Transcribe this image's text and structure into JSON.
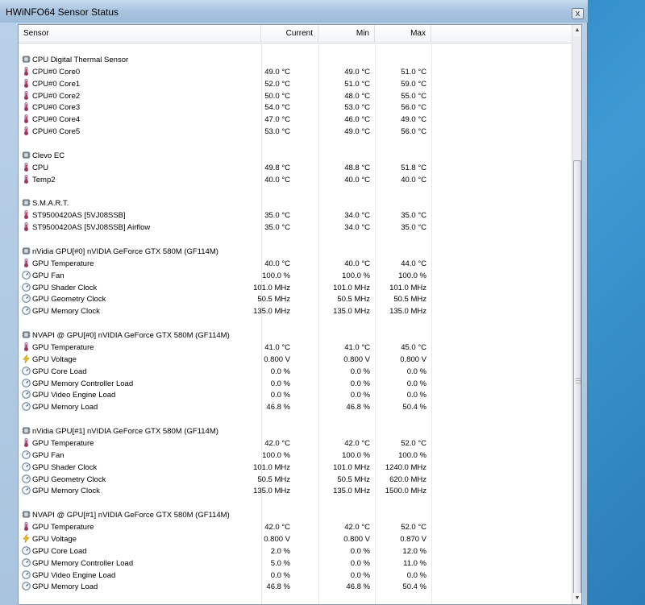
{
  "window": {
    "title": "HWiNFO64 Sensor Status",
    "close_label": "x"
  },
  "columns": {
    "sensor": "Sensor",
    "current": "Current",
    "min": "Min",
    "max": "Max"
  },
  "rows": [
    {
      "type": "blank"
    },
    {
      "type": "group",
      "name": "CPU Digital Thermal Sensor"
    },
    {
      "type": "sensor",
      "icon": "thermometer",
      "name": "CPU#0 Core0",
      "cur": "49.0 °C",
      "min": "49.0 °C",
      "max": "51.0 °C"
    },
    {
      "type": "sensor",
      "icon": "thermometer",
      "name": "CPU#0 Core1",
      "cur": "52.0 °C",
      "min": "51.0 °C",
      "max": "59.0 °C"
    },
    {
      "type": "sensor",
      "icon": "thermometer",
      "name": "CPU#0 Core2",
      "cur": "50.0 °C",
      "min": "48.0 °C",
      "max": "55.0 °C"
    },
    {
      "type": "sensor",
      "icon": "thermometer",
      "name": "CPU#0 Core3",
      "cur": "54.0 °C",
      "min": "53.0 °C",
      "max": "56.0 °C"
    },
    {
      "type": "sensor",
      "icon": "thermometer",
      "name": "CPU#0 Core4",
      "cur": "47.0 °C",
      "min": "46.0 °C",
      "max": "49.0 °C"
    },
    {
      "type": "sensor",
      "icon": "thermometer",
      "name": "CPU#0 Core5",
      "cur": "53.0 °C",
      "min": "49.0 °C",
      "max": "56.0 °C"
    },
    {
      "type": "blank"
    },
    {
      "type": "group",
      "name": "Clevo EC"
    },
    {
      "type": "sensor",
      "icon": "thermometer",
      "name": "CPU",
      "cur": "49.8 °C",
      "min": "48.8 °C",
      "max": "51.8 °C"
    },
    {
      "type": "sensor",
      "icon": "thermometer",
      "name": "Temp2",
      "cur": "40.0 °C",
      "min": "40.0 °C",
      "max": "40.0 °C"
    },
    {
      "type": "blank"
    },
    {
      "type": "group",
      "name": "S.M.A.R.T."
    },
    {
      "type": "sensor",
      "icon": "thermometer",
      "name": "ST9500420AS [5VJ08SSB]",
      "cur": "35.0 °C",
      "min": "34.0 °C",
      "max": "35.0 °C"
    },
    {
      "type": "sensor",
      "icon": "thermometer",
      "name": "ST9500420AS [5VJ08SSB] Airflow",
      "cur": "35.0 °C",
      "min": "34.0 °C",
      "max": "35.0 °C"
    },
    {
      "type": "blank"
    },
    {
      "type": "group",
      "name": "nVidia GPU[#0] nVIDIA GeForce GTX 580M (GF114M)"
    },
    {
      "type": "sensor",
      "icon": "thermometer",
      "name": "GPU Temperature",
      "cur": "40.0 °C",
      "min": "40.0 °C",
      "max": "44.0 °C"
    },
    {
      "type": "sensor",
      "icon": "gauge",
      "name": "GPU Fan",
      "cur": "100.0 %",
      "min": "100.0 %",
      "max": "100.0 %"
    },
    {
      "type": "sensor",
      "icon": "gauge",
      "name": "GPU Shader Clock",
      "cur": "101.0 MHz",
      "min": "101.0 MHz",
      "max": "101.0 MHz"
    },
    {
      "type": "sensor",
      "icon": "gauge",
      "name": "GPU Geometry Clock",
      "cur": "50.5 MHz",
      "min": "50.5 MHz",
      "max": "50.5 MHz"
    },
    {
      "type": "sensor",
      "icon": "gauge",
      "name": "GPU Memory Clock",
      "cur": "135.0 MHz",
      "min": "135.0 MHz",
      "max": "135.0 MHz"
    },
    {
      "type": "blank"
    },
    {
      "type": "group",
      "name": "NVAPI @ GPU[#0] nVIDIA GeForce GTX 580M (GF114M)"
    },
    {
      "type": "sensor",
      "icon": "thermometer",
      "name": "GPU Temperature",
      "cur": "41.0 °C",
      "min": "41.0 °C",
      "max": "45.0 °C"
    },
    {
      "type": "sensor",
      "icon": "bolt",
      "name": "GPU Voltage",
      "cur": "0.800 V",
      "min": "0.800 V",
      "max": "0.800 V"
    },
    {
      "type": "sensor",
      "icon": "gauge",
      "name": "GPU Core Load",
      "cur": "0.0 %",
      "min": "0.0 %",
      "max": "0.0 %"
    },
    {
      "type": "sensor",
      "icon": "gauge",
      "name": "GPU Memory Controller Load",
      "cur": "0.0 %",
      "min": "0.0 %",
      "max": "0.0 %"
    },
    {
      "type": "sensor",
      "icon": "gauge",
      "name": "GPU Video Engine Load",
      "cur": "0.0 %",
      "min": "0.0 %",
      "max": "0.0 %"
    },
    {
      "type": "sensor",
      "icon": "gauge",
      "name": "GPU Memory Load",
      "cur": "46.8 %",
      "min": "46.8 %",
      "max": "50.4 %"
    },
    {
      "type": "blank"
    },
    {
      "type": "group",
      "name": "nVidia GPU[#1] nVIDIA GeForce GTX 580M (GF114M)"
    },
    {
      "type": "sensor",
      "icon": "thermometer",
      "name": "GPU Temperature",
      "cur": "42.0 °C",
      "min": "42.0 °C",
      "max": "52.0 °C"
    },
    {
      "type": "sensor",
      "icon": "gauge",
      "name": "GPU Fan",
      "cur": "100.0 %",
      "min": "100.0 %",
      "max": "100.0 %"
    },
    {
      "type": "sensor",
      "icon": "gauge",
      "name": "GPU Shader Clock",
      "cur": "101.0 MHz",
      "min": "101.0 MHz",
      "max": "1240.0 MHz"
    },
    {
      "type": "sensor",
      "icon": "gauge",
      "name": "GPU Geometry Clock",
      "cur": "50.5 MHz",
      "min": "50.5 MHz",
      "max": "620.0 MHz"
    },
    {
      "type": "sensor",
      "icon": "gauge",
      "name": "GPU Memory Clock",
      "cur": "135.0 MHz",
      "min": "135.0 MHz",
      "max": "1500.0 MHz"
    },
    {
      "type": "blank"
    },
    {
      "type": "group",
      "name": "NVAPI @ GPU[#1] nVIDIA GeForce GTX 580M (GF114M)"
    },
    {
      "type": "sensor",
      "icon": "thermometer",
      "name": "GPU Temperature",
      "cur": "42.0 °C",
      "min": "42.0 °C",
      "max": "52.0 °C"
    },
    {
      "type": "sensor",
      "icon": "bolt",
      "name": "GPU Voltage",
      "cur": "0.800 V",
      "min": "0.800 V",
      "max": "0.870 V"
    },
    {
      "type": "sensor",
      "icon": "gauge",
      "name": "GPU Core Load",
      "cur": "2.0 %",
      "min": "0.0 %",
      "max": "12.0 %"
    },
    {
      "type": "sensor",
      "icon": "gauge",
      "name": "GPU Memory Controller Load",
      "cur": "5.0 %",
      "min": "0.0 %",
      "max": "11.0 %"
    },
    {
      "type": "sensor",
      "icon": "gauge",
      "name": "GPU Video Engine Load",
      "cur": "0.0 %",
      "min": "0.0 %",
      "max": "0.0 %"
    },
    {
      "type": "sensor",
      "icon": "gauge",
      "name": "GPU Memory Load",
      "cur": "46.8 %",
      "min": "46.8 %",
      "max": "50.4 %"
    }
  ]
}
